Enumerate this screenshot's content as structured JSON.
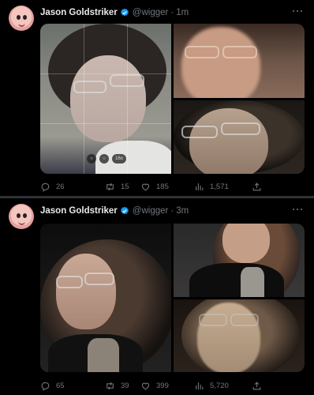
{
  "tweets": [
    {
      "author": {
        "name": "Jason Goldstriker",
        "handle": "@wigger",
        "verified": true
      },
      "time": "1m",
      "media": {
        "layout": "grid-3",
        "alt_badges": [
          "○",
          "○",
          "16x"
        ]
      },
      "stats": {
        "replies": "26",
        "retweets": "15",
        "likes": "185",
        "views": "1,571"
      }
    },
    {
      "author": {
        "name": "Jason Goldstriker",
        "handle": "@wigger",
        "verified": true
      },
      "time": "3m",
      "media": {
        "layout": "grid-3"
      },
      "stats": {
        "replies": "65",
        "retweets": "39",
        "likes": "399",
        "views": "5,720"
      }
    }
  ],
  "colors": {
    "background": "#000000",
    "text": "#e7e9ea",
    "muted": "#71767b",
    "verified": "#1d9bf0",
    "divider": "#2f3336"
  },
  "icons": [
    "verified-badge-icon",
    "more-icon",
    "reply-icon",
    "retweet-icon",
    "like-icon",
    "views-icon",
    "share-icon"
  ]
}
